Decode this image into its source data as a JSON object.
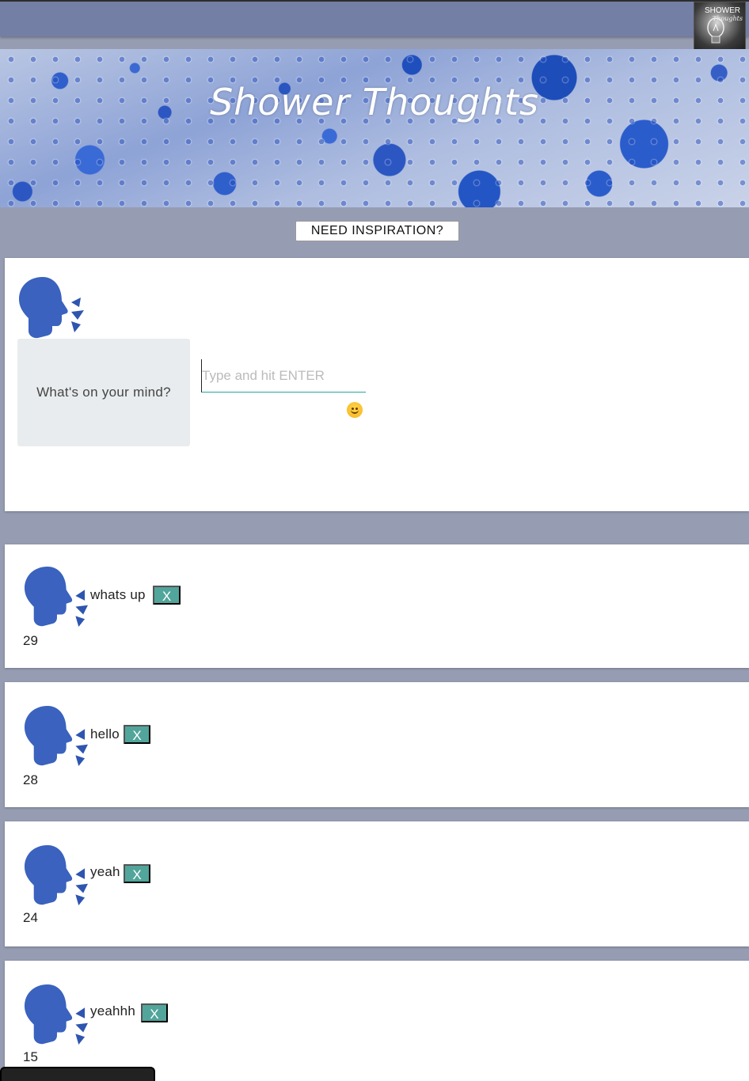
{
  "header": {
    "logo_line1": "SHOWER",
    "logo_line2": "Thoughts"
  },
  "banner": {
    "title": "Shower Thoughts"
  },
  "inspiration_button": "NEED INSPIRATION?",
  "composer": {
    "prompt": "What's on your mind?",
    "input_value": "",
    "input_placeholder": "Type and hit ENTER",
    "icons": [
      "head-speaking-icon",
      "smiley-emoji-icon"
    ]
  },
  "posts": [
    {
      "text": "whats up",
      "delete_label": "X",
      "count": "29"
    },
    {
      "text": "hello",
      "delete_label": "X",
      "count": "28"
    },
    {
      "text": "yeah",
      "delete_label": "X",
      "count": "24"
    },
    {
      "text": "yeahhh",
      "delete_label": "X",
      "count": "15"
    }
  ],
  "colors": {
    "page_bg": "#969db3",
    "top_bar": "#737fa4",
    "accent_teal": "#52a59b",
    "icon_blue": "#3a62be"
  }
}
